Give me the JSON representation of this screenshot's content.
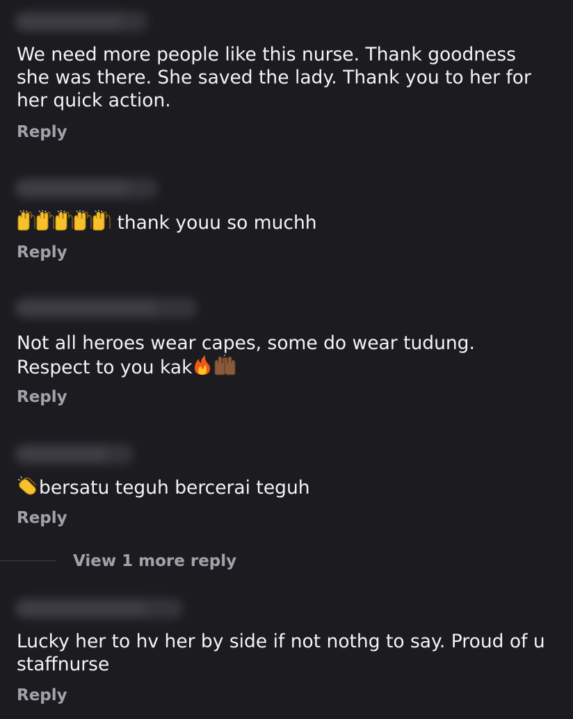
{
  "colors": {
    "background": "#1c1c20",
    "text": "#f4f4f4",
    "secondary_text": "#a2a2aa"
  },
  "comments": [
    {
      "text": "We need more people like this nurse. Thank goodness she was there. She saved the lady. Thank you to her for her quick action.",
      "reply_label": "Reply"
    },
    {
      "text": "thank youu so muchh",
      "emoji_prefix": [
        "raising-hands-icon",
        "raising-hands-icon",
        "raising-hands-icon",
        "raising-hands-icon",
        "raising-hands-icon"
      ],
      "reply_label": "Reply"
    },
    {
      "text": "Not all heroes wear capes, some do wear tudung. Respect to you kak",
      "emoji_suffix": [
        "fire-icon",
        "raising-hands-dark-icon"
      ],
      "reply_label": "Reply"
    },
    {
      "text": "bersatu teguh bercerai teguh",
      "emoji_prefix": [
        "clapping-hands-icon"
      ],
      "reply_label": "Reply",
      "view_more_label": "View 1 more reply"
    },
    {
      "text": "Lucky her to hv her by side if not nothg to say. Proud of u staffnurse",
      "reply_label": "Reply"
    }
  ]
}
